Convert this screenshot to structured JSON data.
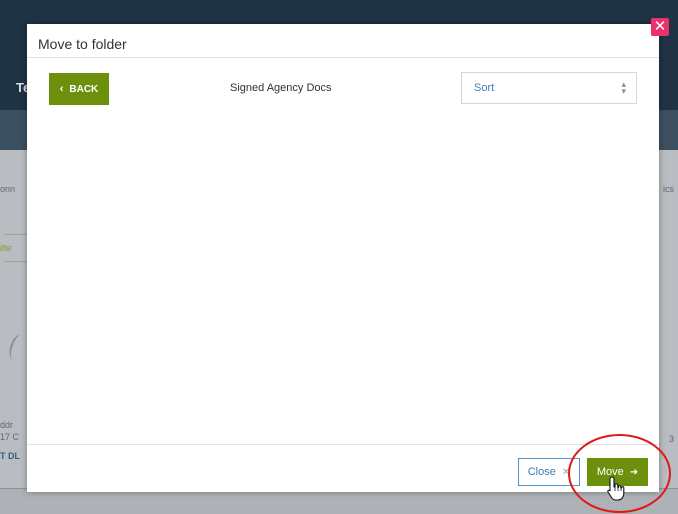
{
  "dialog": {
    "title": "Move to folder",
    "back_label": "BACK",
    "folder_name": "Signed Agency Docs",
    "sort": {
      "selected": "Sort"
    },
    "close_label": "Close",
    "move_label": "Move"
  },
  "background": {
    "topbar_fragment": "Te",
    "left_fragments": [
      "onn",
      "ilte",
      "ddr",
      "17 C",
      "T DL"
    ],
    "right_fragments": [
      "ics",
      "3"
    ]
  },
  "colors": {
    "primary_green": "#6c8f0c",
    "link_blue": "#3a7fb8",
    "close_x_pink": "#e8336a",
    "annotation_red": "#e01818",
    "topbar_dark": "#1f3345"
  },
  "icons": {
    "back": "chevron-left-icon",
    "sort": "updown-arrows-icon",
    "close": "close-icon",
    "move": "arrow-right-icon",
    "dialog_close": "close-x-icon",
    "cursor": "hand-pointer-icon"
  }
}
